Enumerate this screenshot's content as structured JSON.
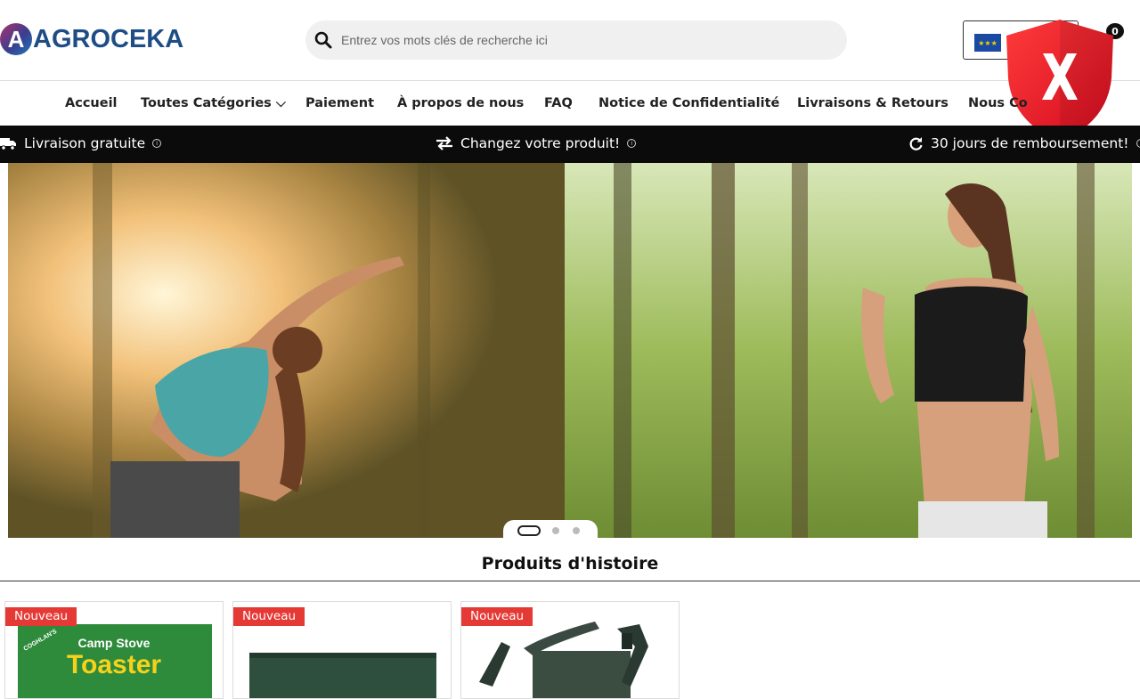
{
  "header": {
    "logo_letter": "A",
    "logo_text": "AGROCEKA",
    "search_placeholder": "Entrez vos mots clés de recherche ici",
    "cart_count": "0"
  },
  "nav": {
    "items": [
      {
        "label": "Accueil"
      },
      {
        "label": "Toutes Catégories ⌵"
      },
      {
        "label": "Paiement"
      },
      {
        "label": "À propos de nous"
      },
      {
        "label": "FAQ"
      },
      {
        "label": "Notice de Confidentialité"
      },
      {
        "label": "Livraisons & Retours"
      },
      {
        "label": "Nous Co"
      }
    ]
  },
  "benefits": [
    {
      "label": "Livraison gratuite",
      "icon": "truck-icon"
    },
    {
      "label": "Changez votre produit!",
      "icon": "exchange-icon"
    },
    {
      "label": "30 jours de remboursement!",
      "icon": "refresh-icon"
    }
  ],
  "slider": {
    "slides": 3,
    "active": 1
  },
  "section": {
    "title": "Produits d'histoire"
  },
  "products": [
    {
      "badge": "Nouveau",
      "image_text_top": "Camp Stove",
      "image_text_main": "Toaster",
      "image_brand": "COGHLAN'S"
    },
    {
      "badge": "Nouveau"
    },
    {
      "badge": "Nouveau"
    }
  ],
  "colors": {
    "brand": "#1e4d86",
    "bar": "#0b0b0b",
    "badge": "#e53935",
    "alert": "#e8132b"
  }
}
